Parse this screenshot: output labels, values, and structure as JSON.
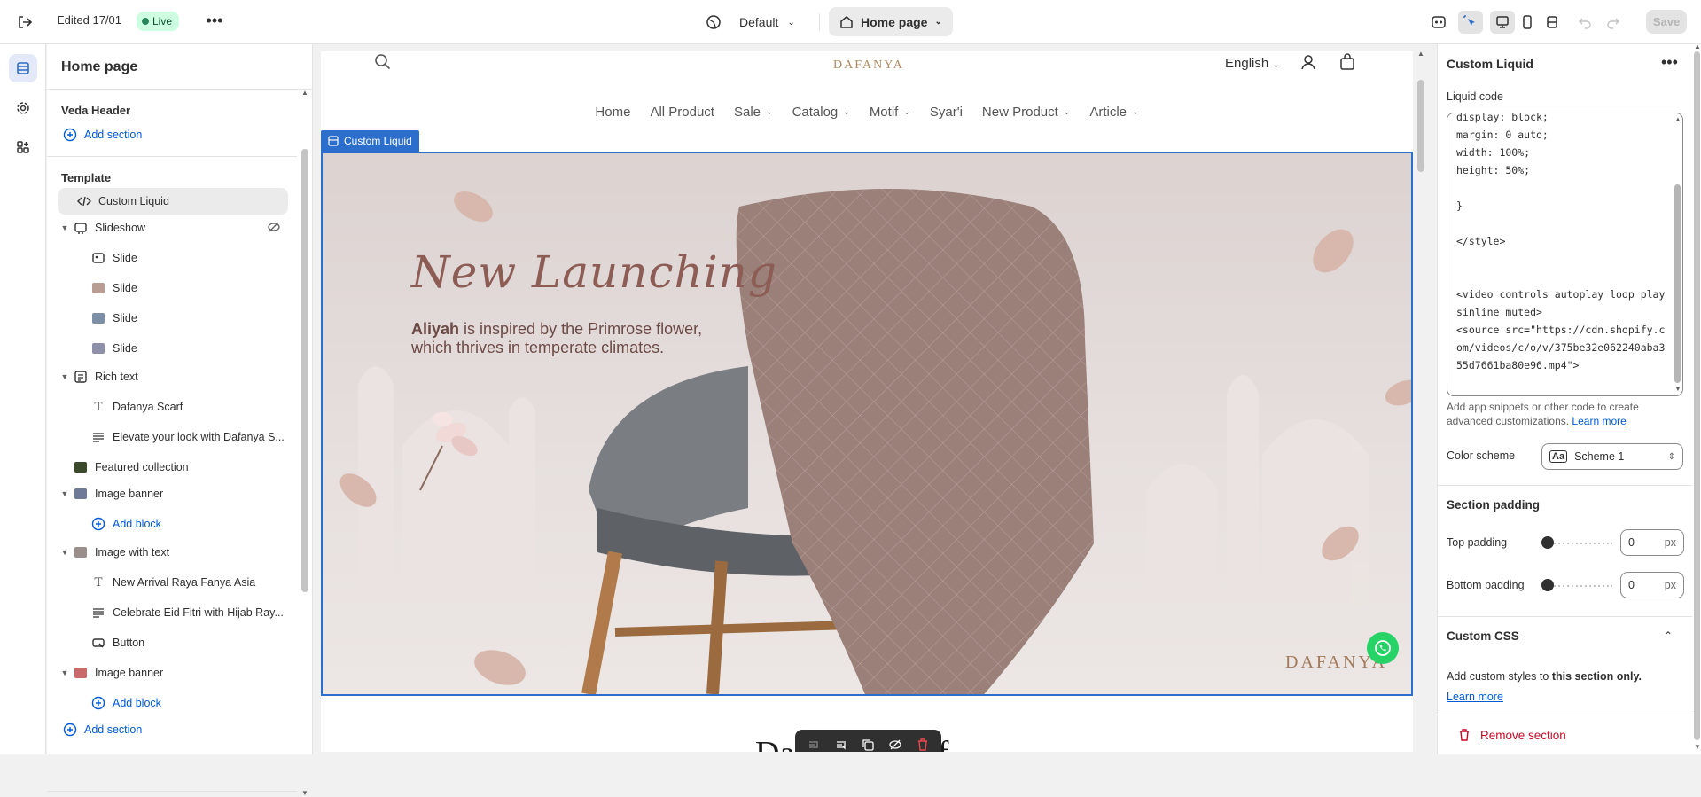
{
  "topbar": {
    "edited": "Edited 17/01",
    "live": "Live",
    "theme": "Default",
    "page": "Home page",
    "save": "Save"
  },
  "sidebar": {
    "title": "Home page",
    "header_group": "Veda Header",
    "add_section": "Add section",
    "template_group": "Template",
    "items": [
      {
        "label": "Custom Liquid"
      },
      {
        "label": "Slideshow"
      },
      {
        "label": "Slide"
      },
      {
        "label": "Slide"
      },
      {
        "label": "Slide"
      },
      {
        "label": "Slide"
      },
      {
        "label": "Rich text"
      },
      {
        "label": "Dafanya Scarf"
      },
      {
        "label": "Elevate your look with Dafanya S..."
      },
      {
        "label": "Featured collection"
      },
      {
        "label": "Image banner"
      },
      {
        "label": "Add block"
      },
      {
        "label": "Image with text"
      },
      {
        "label": "New Arrival Raya Fanya Asia"
      },
      {
        "label": "Celebrate Eid Fitri with Hijab Ray..."
      },
      {
        "label": "Button"
      },
      {
        "label": "Image banner"
      },
      {
        "label": "Add block"
      },
      {
        "label": "Add section"
      }
    ]
  },
  "preview": {
    "logo": "DAFANYA",
    "language": "English",
    "menu": [
      "Home",
      "All Product",
      "Sale",
      "Catalog",
      "Motif",
      "Syar'i",
      "New Product",
      "Article"
    ],
    "section_label": "Custom Liquid",
    "hero_title": "New Launching",
    "hero_sub_bold": "Aliyah",
    "hero_sub_rest": " is inspired by the Primrose flower, which thrives in temperate climates.",
    "hero_logo": "DAFANYA",
    "below_title": "Dafanya Scarf"
  },
  "settings": {
    "title": "Custom Liquid",
    "liquid_label": "Liquid code",
    "code": "display: block;\nmargin: 0 auto;\nwidth: 100%;\nheight: 50%;\n\n}\n\n</style>\n\n\n<video controls autoplay loop playsinline muted>\n<source src=\"https://cdn.shopify.com/videos/c/o/v/375be32e062240aba355d7661ba80e96.mp4\">",
    "help_text": "Add app snippets or other code to create advanced customizations. ",
    "learn_more": "Learn more",
    "color_scheme_label": "Color scheme",
    "color_scheme_value": "Scheme 1",
    "section_padding": "Section padding",
    "top_padding_label": "Top padding",
    "top_padding": "0",
    "bottom_padding_label": "Bottom padding",
    "bottom_padding": "0",
    "unit": "px",
    "custom_css": "Custom CSS",
    "css_text_pre": "Add custom styles to ",
    "css_text_bold": "this section only.",
    "css_learn_more": "Learn more",
    "remove": "Remove section"
  },
  "colors": {
    "accent": "#2c6ecb",
    "link": "#005bd3",
    "danger": "#c70a24",
    "live_bg": "#cdfee1"
  }
}
